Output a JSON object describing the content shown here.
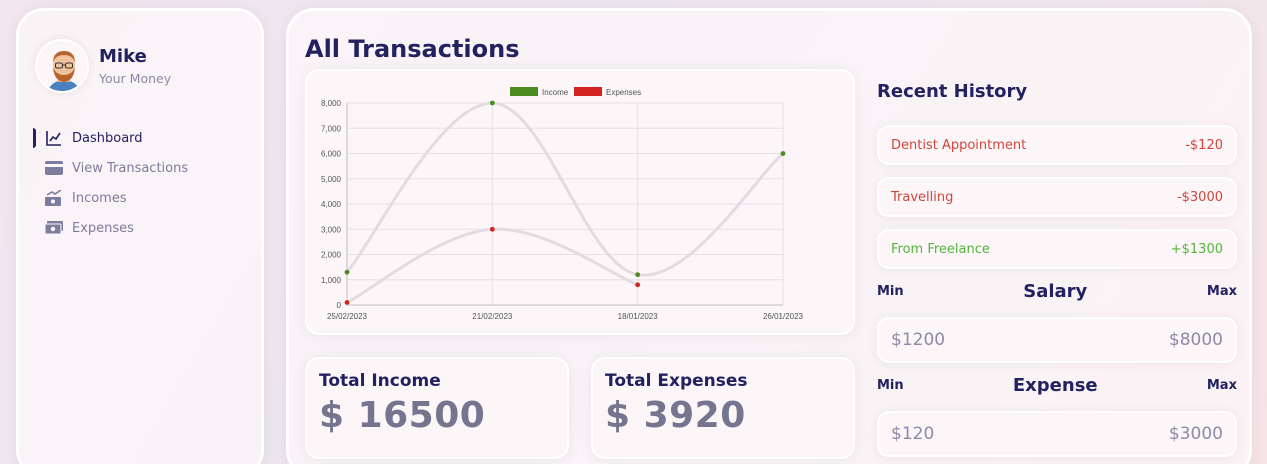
{
  "user": {
    "name": "Mike",
    "subtitle": "Your Money"
  },
  "menu": [
    {
      "label": "Dashboard",
      "icon": "line-chart-icon",
      "active": true
    },
    {
      "label": "View Transactions",
      "icon": "credit-card-icon",
      "active": false
    },
    {
      "label": "Incomes",
      "icon": "money-trend-icon",
      "active": false
    },
    {
      "label": "Expenses",
      "icon": "money-bill-icon",
      "active": false
    }
  ],
  "page_title": "All Transactions",
  "chart_data": {
    "type": "line",
    "categories": [
      "25/02/2023",
      "21/02/2023",
      "18/01/2023",
      "26/01/2023"
    ],
    "series": [
      {
        "name": "Income",
        "color": "#4b8b1f",
        "values": [
          1300,
          8000,
          1200,
          6000
        ]
      },
      {
        "name": "Expenses",
        "color": "#d1241f",
        "values": [
          100,
          3000,
          800,
          null
        ]
      }
    ],
    "ylim": [
      0,
      8000
    ],
    "yticks": [
      "0",
      "1,000",
      "2,000",
      "3,000",
      "4,000",
      "5,000",
      "6,000",
      "7,000",
      "8,000"
    ],
    "legend": "top-center",
    "grid": true
  },
  "totals": {
    "income_label": "Total Income",
    "income_value": "$ 16500",
    "expense_label": "Total Expenses",
    "expense_value": "$ 3920"
  },
  "history": {
    "title": "Recent History",
    "items": [
      {
        "label": "Dentist Appointment",
        "amount": "-$120",
        "type": "expense"
      },
      {
        "label": "Travelling",
        "amount": "-$3000",
        "type": "expense"
      },
      {
        "label": "From Freelance",
        "amount": "+$1300",
        "type": "income"
      }
    ]
  },
  "salary": {
    "title": "Salary",
    "min_label": "Min",
    "max_label": "Max",
    "min": "$1200",
    "max": "$8000"
  },
  "expense": {
    "title": "Expense",
    "min_label": "Min",
    "max_label": "Max",
    "min": "$120",
    "max": "$3000"
  },
  "colors": {
    "navy": "#222260",
    "income_green": "#54b53c",
    "expense_red": "#d0453b"
  }
}
